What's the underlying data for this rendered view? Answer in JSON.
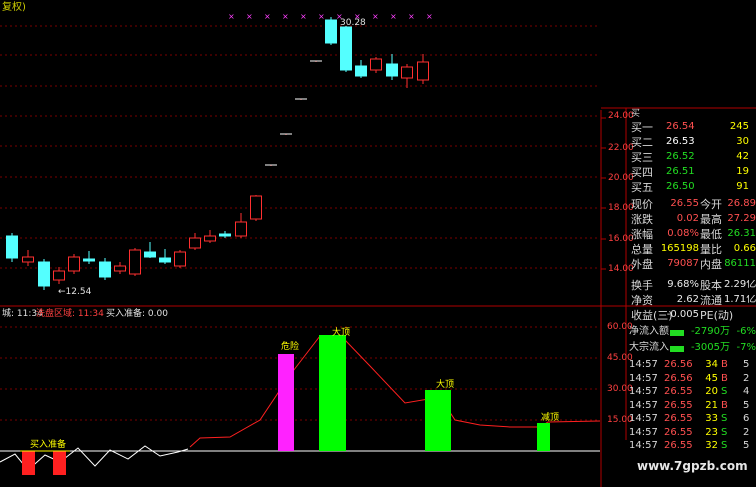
{
  "title_fragment": "复权)",
  "chart": {
    "high_label": "30.28",
    "low_label": "12.54",
    "price_ticks": [
      "24.00",
      "22.00",
      "20.00",
      "18.00",
      "16.00",
      "14.00"
    ],
    "colors": {
      "up": "#ff3030",
      "down": "#54ffff",
      "grid": "#7a0000",
      "axis": "#b00000"
    }
  },
  "indicator": {
    "status_left": "城: 11:34",
    "status_mid": "洗盘区域: 11:34",
    "status_buy": "买入准备: 0.00",
    "ticks": [
      "60.00",
      "45.00",
      "30.00",
      "15.00"
    ],
    "labels": {
      "risk": "危险",
      "top1": "大顶",
      "top2": "大顶",
      "reduce": "减顶",
      "buy": "买入准备"
    },
    "colors": {
      "risk": "#ff22ff",
      "top": "#00ff00",
      "buy_bar": "#ff2020"
    }
  },
  "order_book": {
    "partial_top": "买",
    "rows": [
      {
        "label": "买一",
        "price": "26.54",
        "vol": "245"
      },
      {
        "label": "买二",
        "price": "26.53",
        "vol": "30"
      },
      {
        "label": "买三",
        "price": "26.52",
        "vol": "42"
      },
      {
        "label": "买四",
        "price": "26.51",
        "vol": "19"
      },
      {
        "label": "买五",
        "price": "26.50",
        "vol": "91"
      }
    ]
  },
  "quote": {
    "rows": [
      {
        "l1": "现价",
        "v1": "26.55",
        "c1": "red",
        "l2": "今开",
        "v2": "26.89",
        "c2": "red"
      },
      {
        "l1": "涨跌",
        "v1": "0.02",
        "c1": "red",
        "l2": "最高",
        "v2": "27.29",
        "c2": "red"
      },
      {
        "l1": "涨幅",
        "v1": "0.08%",
        "c1": "red",
        "l2": "最低",
        "v2": "26.31",
        "c2": "grn"
      },
      {
        "l1": "总量",
        "v1": "165198",
        "c1": "yel",
        "l2": "量比",
        "v2": "0.66",
        "c2": "yel"
      },
      {
        "l1": "外盘",
        "v1": "79087",
        "c1": "red",
        "l2": "内盘",
        "v2": "86111",
        "c2": "grn"
      },
      {
        "l1": "换手",
        "v1": "9.68%",
        "c1": "wht",
        "l2": "股本",
        "v2": "2.29亿",
        "c2": "wht"
      },
      {
        "l1": "净资",
        "v1": "2.62",
        "c1": "wht",
        "l2": "流通",
        "v2": "1.71亿",
        "c2": "wht"
      },
      {
        "l1": "收益(三)",
        "v1": "-0.005",
        "c1": "wht",
        "l2": "PE(动)",
        "v2": "",
        "c2": "wht"
      }
    ]
  },
  "flows": [
    {
      "label": "净流入额",
      "value": "-2790万",
      "pct": "-6%"
    },
    {
      "label": "大宗流入",
      "value": "-3005万",
      "pct": "-7%"
    }
  ],
  "ticks_list": [
    {
      "time": "14:57",
      "price": "26.56",
      "vol": "34",
      "side": "B",
      "n": "5"
    },
    {
      "time": "14:57",
      "price": "26.56",
      "vol": "45",
      "side": "B",
      "n": "2"
    },
    {
      "time": "14:57",
      "price": "26.55",
      "vol": "20",
      "side": "S",
      "n": "4"
    },
    {
      "time": "14:57",
      "price": "26.55",
      "vol": "21",
      "side": "B",
      "n": "5"
    },
    {
      "time": "14:57",
      "price": "26.55",
      "vol": "33",
      "side": "S",
      "n": "6"
    },
    {
      "time": "14:57",
      "price": "26.55",
      "vol": "23",
      "side": "S",
      "n": "2"
    },
    {
      "time": "14:57",
      "price": "26.55",
      "vol": "32",
      "side": "S",
      "n": "5"
    }
  ],
  "watermark": "www.7gpzb.com"
}
